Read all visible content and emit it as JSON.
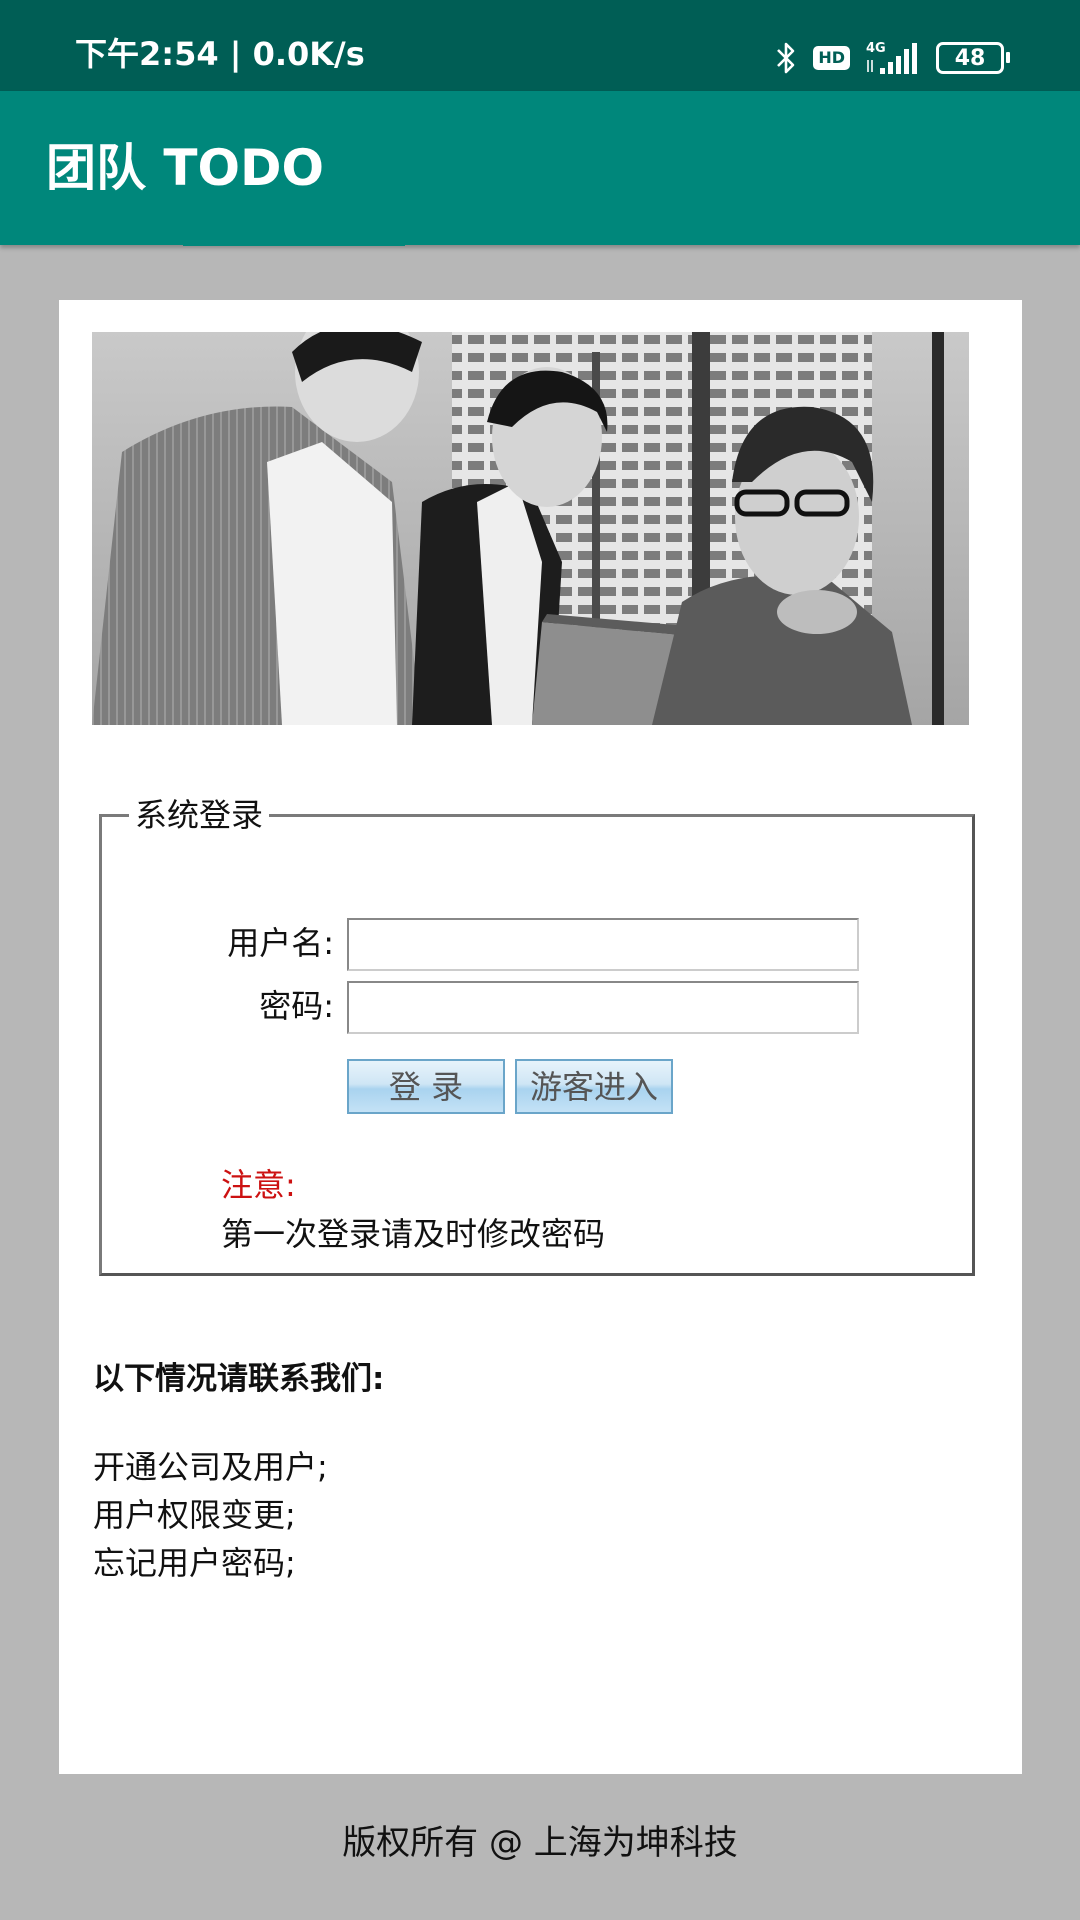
{
  "status_bar": {
    "time": "下午2:54 | 0.0K/s",
    "hd_label": "HD",
    "network_label": "4G",
    "battery_level": "48"
  },
  "app_bar": {
    "title": "团队 TODO",
    "color": "#00877b"
  },
  "login_box": {
    "legend": "系统登录",
    "username_label": "用户名:",
    "password_label": "密码:",
    "username_value": "",
    "password_value": "",
    "login_button": "登 录",
    "guest_button": "游客进入",
    "note_label": "注意:",
    "note_text": "第一次登录请及时修改密码"
  },
  "contact": {
    "title": "以下情况请联系我们:",
    "items": [
      "开通公司及用户;",
      "用户权限变更;",
      "忘记用户密码;"
    ]
  },
  "footer": {
    "copyright": "版权所有 @ 上海为坤科技"
  },
  "icons": {
    "bluetooth": "bluetooth-icon",
    "hd": "hd-icon",
    "signal": "signal-icon",
    "battery": "battery-icon"
  }
}
